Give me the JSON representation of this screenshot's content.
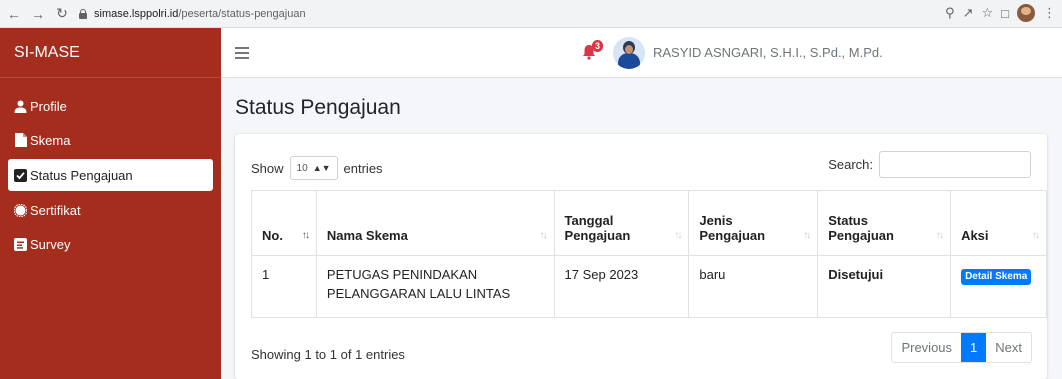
{
  "browser": {
    "url_host": "simase.lsppolri.id",
    "url_path": "/peserta/status-pengajuan"
  },
  "sidebar": {
    "brand": "SI-MASE",
    "items": [
      {
        "label": "Profile",
        "icon": "user-icon",
        "active": false
      },
      {
        "label": "Skema",
        "icon": "file-icon",
        "active": false
      },
      {
        "label": "Status Pengajuan",
        "icon": "checkbox-icon",
        "active": true
      },
      {
        "label": "Sertifikat",
        "icon": "certificate-icon",
        "active": false
      },
      {
        "label": "Survey",
        "icon": "survey-icon",
        "active": false
      }
    ]
  },
  "topbar": {
    "notification_count": "3",
    "user_name": "RASYID ASNGARI, S.H.I., S.Pd., M.Pd."
  },
  "page": {
    "title": "Status Pengajuan"
  },
  "table": {
    "length_label_pre": "Show",
    "length_value": "10",
    "length_label_post": "entries",
    "search_label": "Search:",
    "search_value": "",
    "columns": [
      "No.",
      "Nama Skema",
      "Tanggal Pengajuan",
      "Jenis Pengajuan",
      "Status Pengajuan",
      "Aksi"
    ],
    "col_tanggal_1": "Tanggal",
    "col_tanggal_2": "Pengajuan",
    "col_jenis_1": "Jenis",
    "col_jenis_2": "Pengajuan",
    "col_status_1": "Status",
    "col_status_2": "Pengajuan",
    "rows": [
      {
        "no": "1",
        "nama_skema_1": "PETUGAS PENINDAKAN",
        "nama_skema_2": "PELANGGARAN LALU LINTAS",
        "tanggal": "17 Sep 2023",
        "jenis": "baru",
        "status": "Disetujui",
        "aksi": "Detail Skema"
      }
    ],
    "info": "Showing 1 to 1 of 1 entries",
    "pager": {
      "previous": "Previous",
      "current": "1",
      "next": "Next"
    }
  },
  "colors": {
    "sidebar_bg": "#a52d1e",
    "accent": "#007bff",
    "badge": "#dc3545"
  }
}
